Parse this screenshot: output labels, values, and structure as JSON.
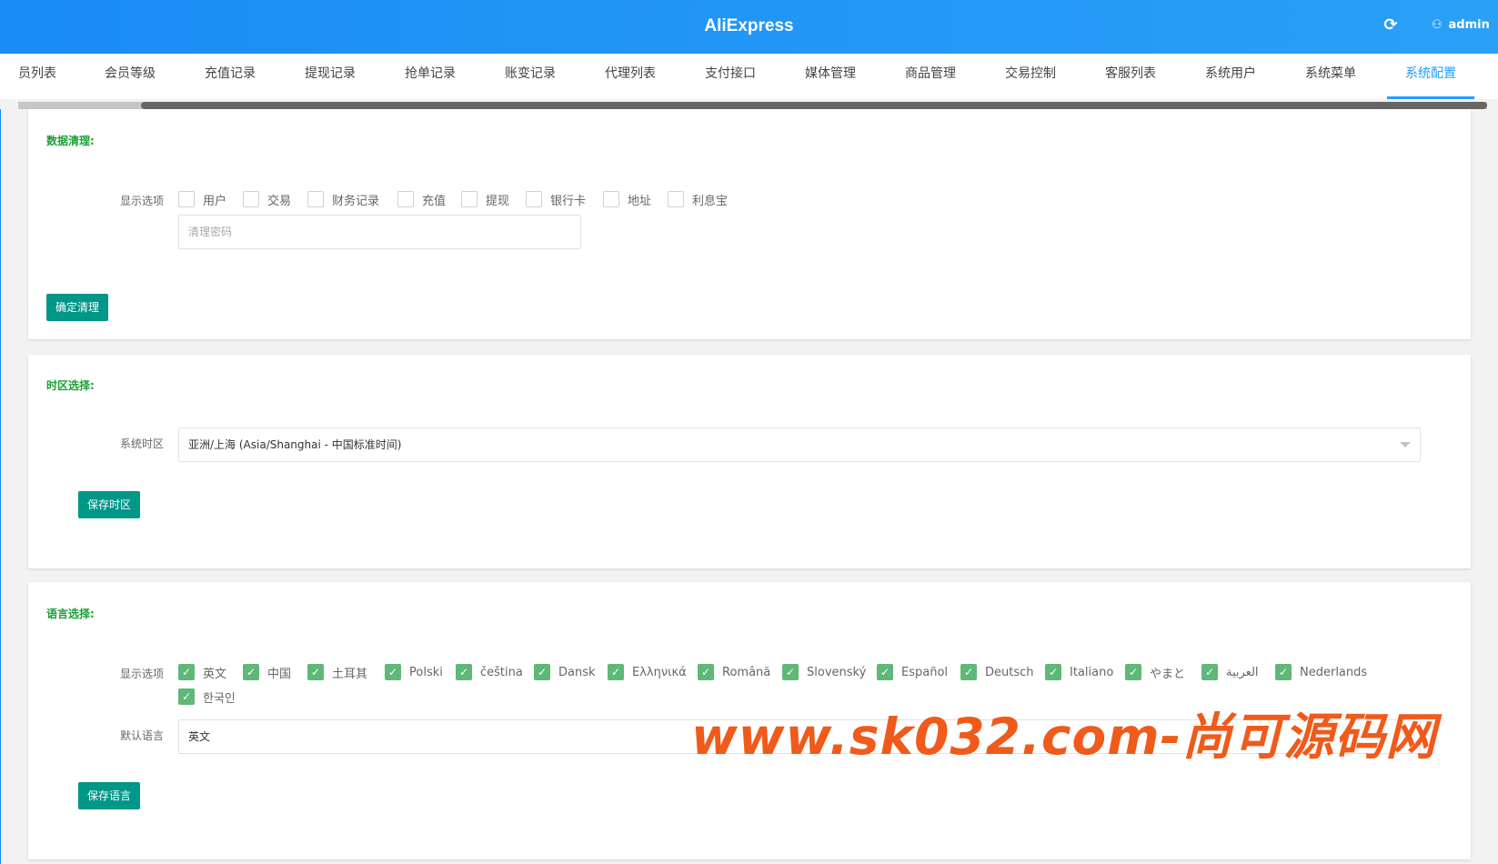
{
  "header": {
    "title": "AliExpress",
    "refresh_icon": "refresh-icon",
    "user": "admin"
  },
  "tabs": [
    "员列表",
    "会员等级",
    "充值记录",
    "提现记录",
    "抢单记录",
    "账变记录",
    "代理列表",
    "支付接口",
    "媒体管理",
    "商品管理",
    "交易控制",
    "客服列表",
    "系统用户",
    "系统菜单",
    "系统配置"
  ],
  "active_tab": "系统配置",
  "data_clean": {
    "title": "数据清理:",
    "options_label": "显示选项",
    "options": [
      "用户",
      "交易",
      "财务记录",
      "充值",
      "提现",
      "银行卡",
      "地址",
      "利息宝"
    ],
    "password_placeholder": "清理密码",
    "confirm_button": "确定清理"
  },
  "timezone": {
    "title": "时区选择:",
    "label": "系统时区",
    "value": "亚洲/上海 (Asia/Shanghai - 中国标准时间)",
    "save_button": "保存时区"
  },
  "language": {
    "title": "语言选择:",
    "options_label": "显示选项",
    "options": [
      "英文",
      "中国",
      "土耳其",
      "Polski",
      "čeština",
      "Dansk",
      "Ελληνικά",
      "Română",
      "Slovenský",
      "Español",
      "Deutsch",
      "Italiano",
      "やまと",
      "العربية",
      "Nederlands",
      "한국인"
    ],
    "default_label": "默认语言",
    "default_value": "英文",
    "save_button": "保存语言"
  },
  "watermark": "www.sk032.com-尚可源码网",
  "colors": {
    "header": "#1e9fff",
    "button": "#009688",
    "checked": "#5fb878",
    "section_title": "#1aa034",
    "watermark": "#f05a1a"
  }
}
